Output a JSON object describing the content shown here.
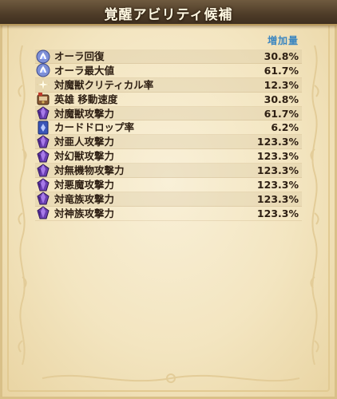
{
  "header": {
    "title": "覚醒アビリティ候補"
  },
  "list": {
    "column_label": "増加量",
    "rows": [
      {
        "icon": "aura-recovery-icon",
        "name": "オーラ回復",
        "value": "30.8%"
      },
      {
        "icon": "aura-max-icon",
        "name": "オーラ最大値",
        "value": "61.7%"
      },
      {
        "icon": "sparkle-icon",
        "name": "対魔獣クリティカル率",
        "value": "12.3%"
      },
      {
        "icon": "hero-treasure-icon",
        "name": "英雄 移動速度",
        "value": "30.8%"
      },
      {
        "icon": "purple-gem-icon",
        "name": "対魔獣攻撃力",
        "value": "61.7%"
      },
      {
        "icon": "blue-card-icon",
        "name": "カードドロップ率",
        "value": "6.2%"
      },
      {
        "icon": "purple-gem-icon",
        "name": "対亜人攻撃力",
        "value": "123.3%"
      },
      {
        "icon": "purple-gem-icon",
        "name": "対幻獣攻撃力",
        "value": "123.3%"
      },
      {
        "icon": "purple-gem-icon",
        "name": "対無機物攻撃力",
        "value": "123.3%"
      },
      {
        "icon": "purple-gem-icon",
        "name": "対悪魔攻撃力",
        "value": "123.3%"
      },
      {
        "icon": "purple-gem-icon",
        "name": "対竜族攻撃力",
        "value": "123.3%"
      },
      {
        "icon": "purple-gem-icon",
        "name": "対神族攻撃力",
        "value": "123.3%"
      }
    ]
  }
}
